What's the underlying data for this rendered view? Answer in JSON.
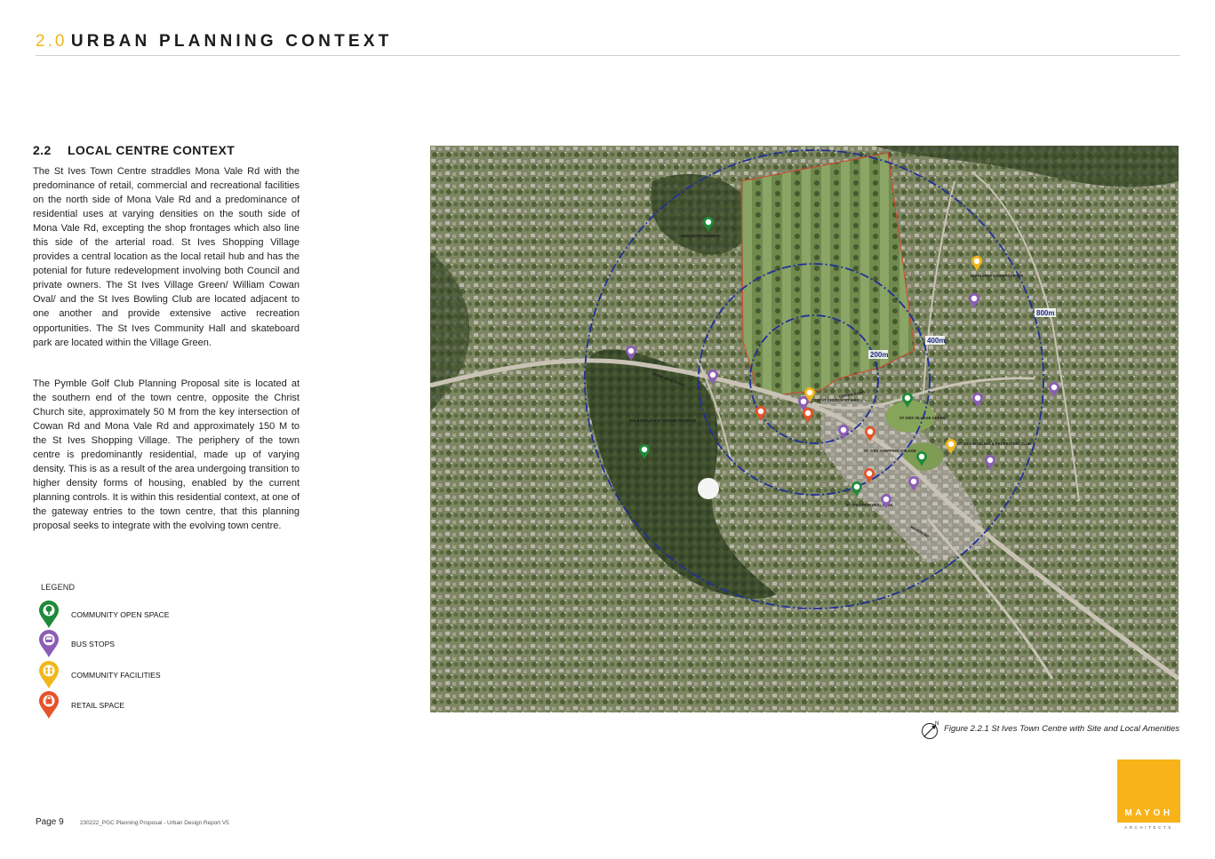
{
  "header": {
    "number": "2.0",
    "title": "URBAN PLANNING CONTEXT"
  },
  "section": {
    "number": "2.2",
    "title": "LOCAL CENTRE CONTEXT"
  },
  "paragraphs": [
    "The St Ives Town Centre straddles Mona Vale Rd with the predominance of retail, commercial and recreational facilities on the north side of Mona Vale Rd and a predominance of residential uses at varying densities on the south side of Mona Vale Rd, excepting the shop frontages which also line this side of the arterial road. St Ives Shopping Village provides a central location as the local retail hub and has the potenial for future redevelopment involving both Council and private owners. The St Ives Village Green/ William Cowan Oval/ and the St Ives Bowling Club are located adjacent to one another and provide extensive active recreation opportunities. The St Ives Community Hall and skateboard park are located within the Village Green.",
    "The Pymble Golf Club Planning Proposal site is located at the southern end of the town centre, opposite the Christ Church site, approximately 50 M from the key intersection of Cowan Rd and Mona Vale Rd and approximately 150 M to the St Ives Shopping Village. The periphery of the town centre is predominantly residential, made up of varying density. This is as a result of the area undergoing transition to higher density forms of housing, enabled by the current planning controls. It is within this residential context, at one of the gateway entries to the town centre, that this planning proposal seeks to integrate with the evolving town centre."
  ],
  "legend": {
    "title": "LEGEND",
    "items": [
      {
        "label": "COMMUNITY OPEN SPACE",
        "color": "#1f8a3a",
        "icon": "tree-icon"
      },
      {
        "label": "BUS STOPS",
        "color": "#8c5db5",
        "icon": "bus-icon"
      },
      {
        "label": "COMMUNITY FACILITIES",
        "color": "#f2b619",
        "icon": "people-icon"
      },
      {
        "label": "RETAIL SPACE",
        "color": "#e5532a",
        "icon": "shopping-bag-icon"
      }
    ]
  },
  "map": {
    "radius_labels": [
      "200m",
      "400m",
      "800m"
    ],
    "places": [
      "MADDISON RESERVE",
      "DALRYMPLE-HAY NATURE RESERVE",
      "CHRIST CHURCH ST IVES",
      "ST IVES VILLAGE GREEN",
      "ST IVES SHOPPING VILLAGE",
      "ST IVES BOWLING & RECREATION CLUB",
      "ST IVES MEMORIAL PARK",
      "BUNGARRA KINDERGARTEN"
    ],
    "roads": [
      "MONA VALE ROAD",
      "COWAN ROAD",
      "MAHON RD"
    ]
  },
  "figure_caption": "Figure 2.2.1 St Ives Town Centre with Site and Local Amenities",
  "north_label": "N",
  "footer": {
    "page": "Page 9",
    "doc": "230222_PGC Planning Proposal - Urban Design Report V5"
  },
  "logo": {
    "name": "MAYOH",
    "sub": "ARCHITECTS",
    "color": "#f7b319"
  }
}
